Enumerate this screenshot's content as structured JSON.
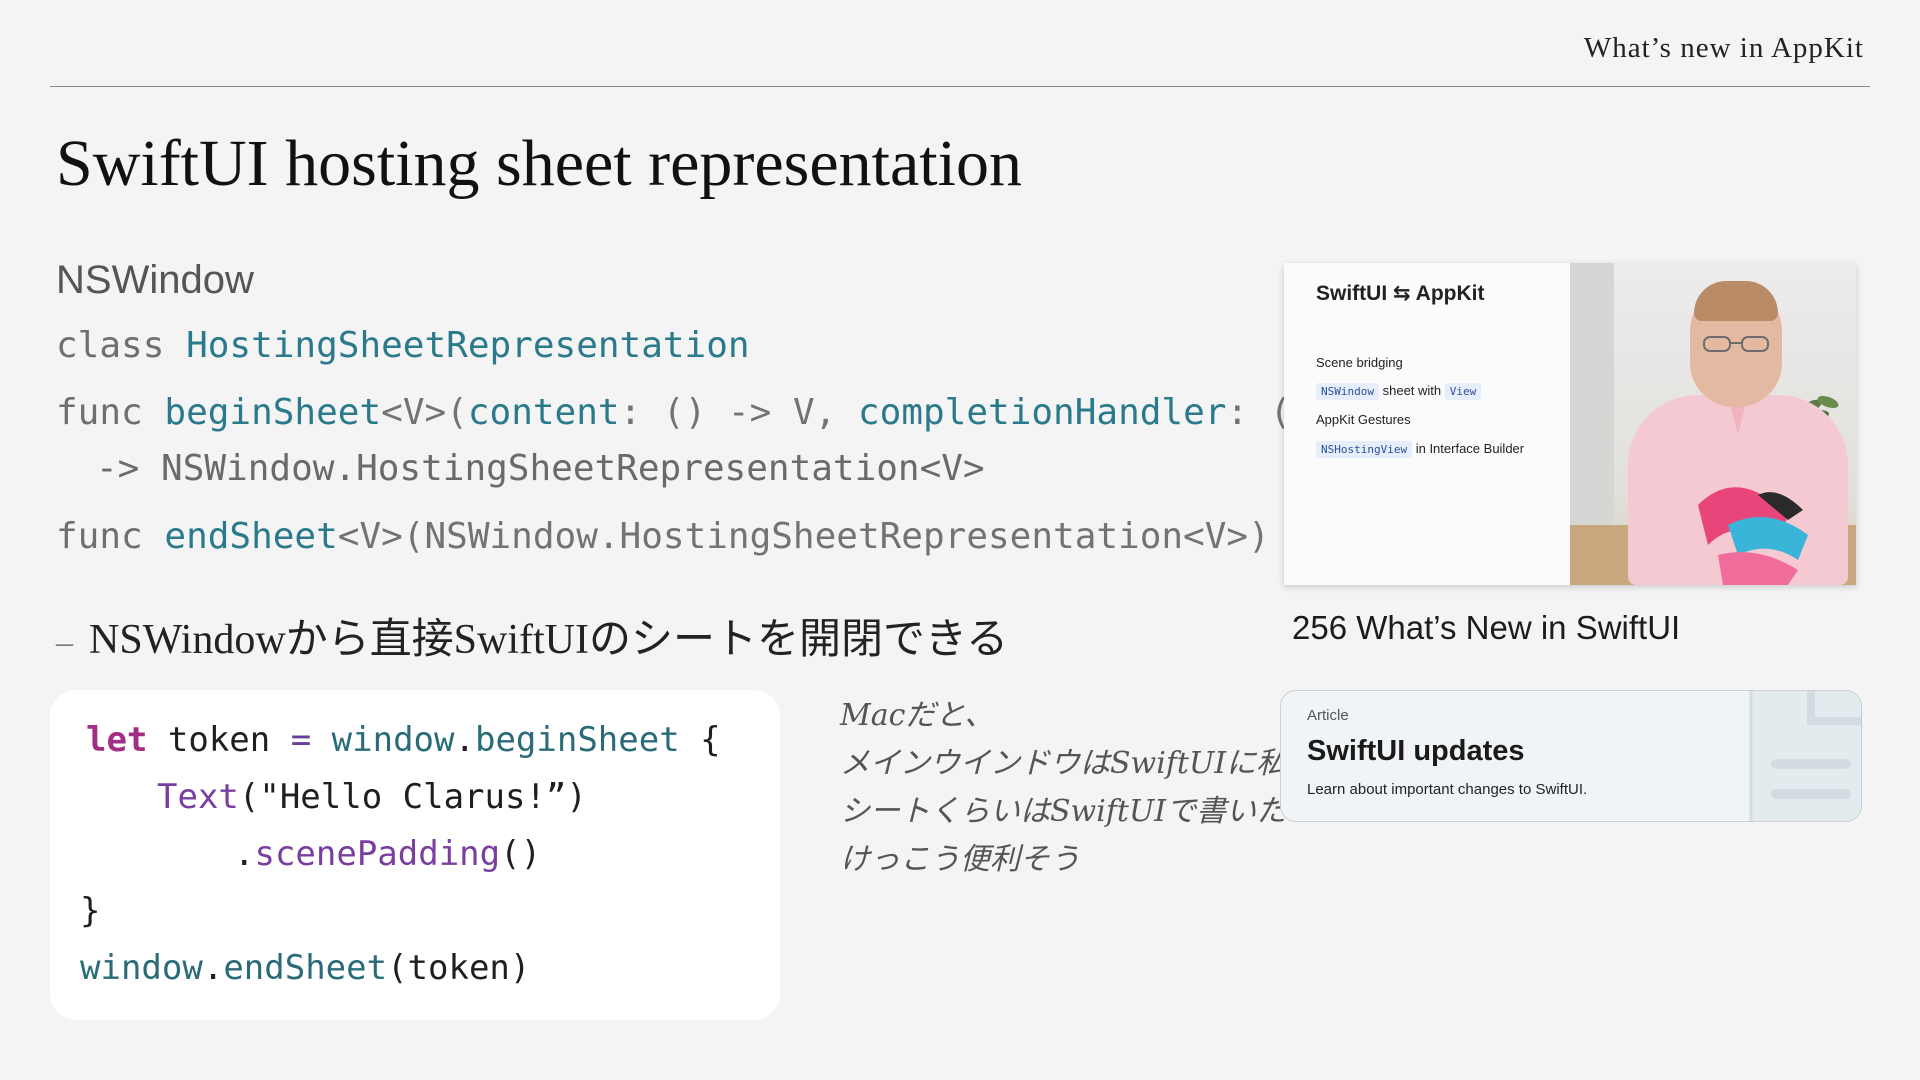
{
  "header": {
    "label": "What’s new in AppKit"
  },
  "slide": {
    "title": "SwiftUI hosting sheet representation",
    "api_owner": "NSWindow",
    "signatures": {
      "class_kw": "class",
      "class_name": "HostingSheetRepresentation",
      "begin_kw": "func",
      "begin_name": "beginSheet",
      "begin_generic": "<V>(",
      "begin_param1": "content",
      "begin_param1_type": ": () -> V, ",
      "begin_param2": "completionHandler",
      "begin_param2_type": ": ((",
      "begin_return": "-> NSWindow.HostingSheetRepresentation<V>",
      "end_kw": "func",
      "end_name": "endSheet",
      "end_params": "<V>(NSWindow.HostingSheetRepresentation<V>)"
    },
    "bullet_dash": "–",
    "bullet": "NSWindowから直接SwiftUIのシートを開閉できる"
  },
  "code_sample": {
    "l1_kw": "let",
    "l1_var": " token ",
    "l1_eq": "=",
    "l1_obj": " window",
    "l1_dot": ".",
    "l1_fn": "beginSheet",
    "l1_brace": " {",
    "l2_fn": "Text",
    "l2_args": "(\"Hello Clarus!”)",
    "l3_dot": ".",
    "l3_fn": "scenePadding",
    "l3_args": "()",
    "l4": "}",
    "l5_obj": "window",
    "l5_dot": ".",
    "l5_fn": "endSheet",
    "l5_args": "(token)"
  },
  "handwritten_note": {
    "line1": "Macだと、",
    "line2": "メインウインドウはSwiftUIに私",
    "line3": "シートくらいはSwiftUIで書いた",
    "line4": "けっこう便利そう"
  },
  "video": {
    "thumb_title": "SwiftUI ⇆ AppKit",
    "item1": "Scene bridging",
    "item2_code": "NSWindow",
    "item2_text": "sheet with",
    "item2_code2": "View",
    "item3": "AppKit Gestures",
    "item4_code": "NSHostingView",
    "item4_text": "in Interface Builder",
    "caption": "256 What’s New in SwiftUI"
  },
  "article": {
    "kind": "Article",
    "title": "SwiftUI updates",
    "description": "Learn about important changes to SwiftUI."
  },
  "colors": {
    "background": "#f4f4f4",
    "code_type_teal": "#2b7a8c",
    "code_keyword_magenta": "#a12d86",
    "code_function_purple": "#7a3ea1"
  }
}
